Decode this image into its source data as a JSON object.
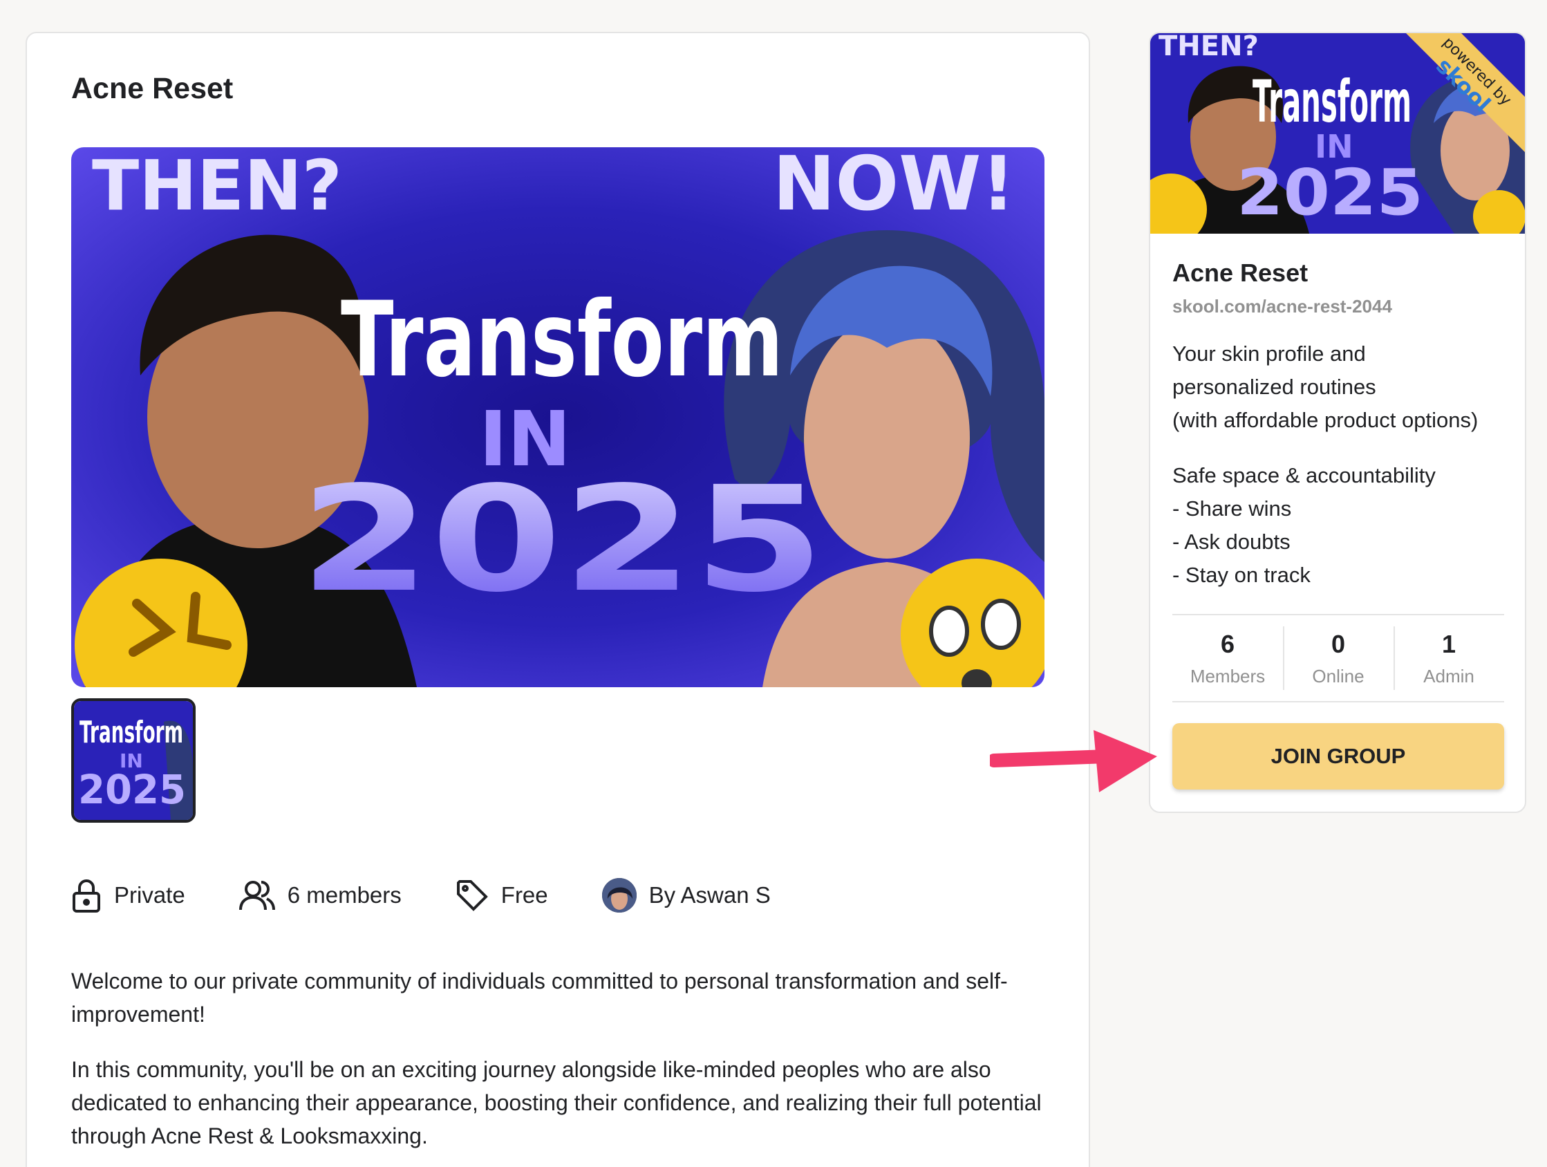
{
  "main": {
    "title": "Acne Reset",
    "hero": {
      "text_then": "THEN?",
      "text_now": "NOW!",
      "text_transform": "Transform",
      "text_in": "IN",
      "text_year": "2025"
    },
    "thumbnail": {
      "text_transform": "Transform",
      "text_in": "IN",
      "text_year": "2025"
    },
    "meta": {
      "privacy": "Private",
      "members": "6 members",
      "price": "Free",
      "owner": "By Aswan S"
    },
    "description": [
      "Welcome to our private community of individuals committed to personal transformation and self-improvement!",
      "In this community, you'll be on an exciting journey alongside like-minded peoples who are also dedicated to enhancing their appearance, boosting their confidence, and realizing their full potential through Acne Rest & Looksmaxxing."
    ]
  },
  "sidebar": {
    "banner": {
      "text_then": "THEN?",
      "text_transform": "Transform",
      "text_in": "IN",
      "text_year": "2025",
      "ribbon_powered": "powered by",
      "ribbon_brand": "skool"
    },
    "name": "Acne Reset",
    "url": "skool.com/acne-rest-2044",
    "description_lines": [
      "Your skin profile and",
      "personalized routines",
      "(with affordable product options)",
      "Safe space & accountability",
      "- Share wins",
      "- Ask doubts",
      "- Stay on track"
    ],
    "stats": [
      {
        "value": "6",
        "label": "Members"
      },
      {
        "value": "0",
        "label": "Online"
      },
      {
        "value": "1",
        "label": "Admin"
      }
    ],
    "join_label": "JOIN GROUP"
  },
  "colors": {
    "join_button": "#f8d481",
    "arrow": "#f23a6b",
    "hero_background": "#3a2fc8"
  },
  "icons": [
    "lock-icon",
    "members-icon",
    "tag-icon",
    "owner-avatar",
    "arrow-icon"
  ]
}
